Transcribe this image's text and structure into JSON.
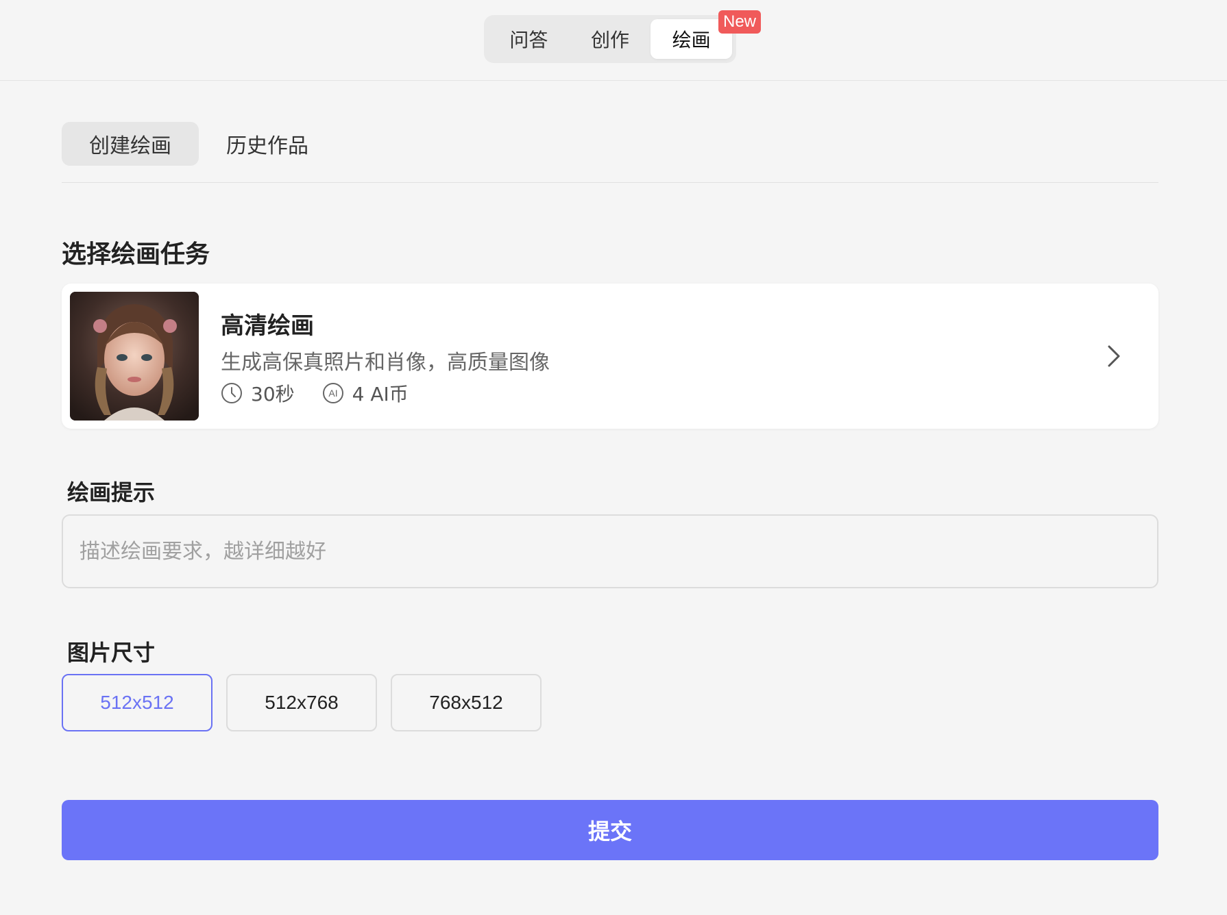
{
  "top_tabs": [
    {
      "label": "问答"
    },
    {
      "label": "创作"
    },
    {
      "label": "绘画"
    }
  ],
  "new_badge": "New",
  "sub_tabs": [
    {
      "label": "创建绘画"
    },
    {
      "label": "历史作品"
    }
  ],
  "section": {
    "title": "选择绘画任务"
  },
  "task": {
    "name": "高清绘画",
    "description": "生成高保真照片和肖像，高质量图像",
    "time": "30秒",
    "cost": "4 AI币",
    "thumbnail_icon": "portrait-image"
  },
  "prompt": {
    "label": "绘画提示",
    "placeholder": "描述绘画要求，越详细越好",
    "value": ""
  },
  "size": {
    "label": "图片尺寸",
    "options": [
      "512x512",
      "512x768",
      "768x512"
    ],
    "selected": "512x512"
  },
  "submit_label": "提交",
  "colors": {
    "accent": "#6b74f8",
    "badge": "#f05a5a",
    "background": "#f5f5f5"
  }
}
